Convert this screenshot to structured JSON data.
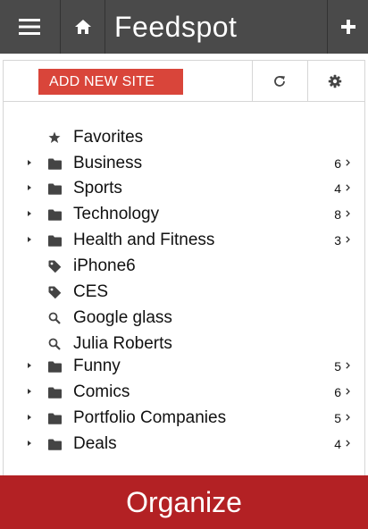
{
  "app": {
    "title": "Feedspot"
  },
  "topbar": {
    "menu_icon": "hamburger-menu-icon",
    "home_icon": "home-icon",
    "add_icon": "plus-icon"
  },
  "toolbar": {
    "add_site_label": "ADD NEW SITE",
    "refresh_icon": "refresh-icon",
    "settings_icon": "gear-icon"
  },
  "list": {
    "items": [
      {
        "label": "Favorites",
        "icon": "star-icon",
        "expandable": false,
        "count": ""
      },
      {
        "label": "Business",
        "icon": "folder-icon",
        "expandable": true,
        "count": "6"
      },
      {
        "label": "Sports",
        "icon": "folder-icon",
        "expandable": true,
        "count": "4"
      },
      {
        "label": "Technology",
        "icon": "folder-icon",
        "expandable": true,
        "count": "8"
      },
      {
        "label": "Health and Fitness",
        "icon": "folder-icon",
        "expandable": true,
        "count": "3"
      },
      {
        "label": "iPhone6",
        "icon": "tag-icon",
        "expandable": false,
        "count": ""
      },
      {
        "label": "CES",
        "icon": "tag-icon",
        "expandable": false,
        "count": ""
      },
      {
        "label": "Google glass",
        "icon": "search-icon",
        "expandable": false,
        "count": ""
      },
      {
        "label": "Julia Roberts",
        "icon": "search-icon",
        "expandable": false,
        "count": ""
      },
      {
        "label": "Funny",
        "icon": "folder-icon",
        "expandable": true,
        "count": "5"
      },
      {
        "label": "Comics",
        "icon": "folder-icon",
        "expandable": true,
        "count": "6"
      },
      {
        "label": "Portfolio Companies",
        "icon": "folder-icon",
        "expandable": true,
        "count": "5"
      },
      {
        "label": "Deals",
        "icon": "folder-icon",
        "expandable": true,
        "count": "4"
      }
    ]
  },
  "bottombar": {
    "label": "Organize"
  },
  "colors": {
    "topbar": "#4a4a4a",
    "add_site_button": "#d9453a",
    "bottombar": "#b32124"
  }
}
